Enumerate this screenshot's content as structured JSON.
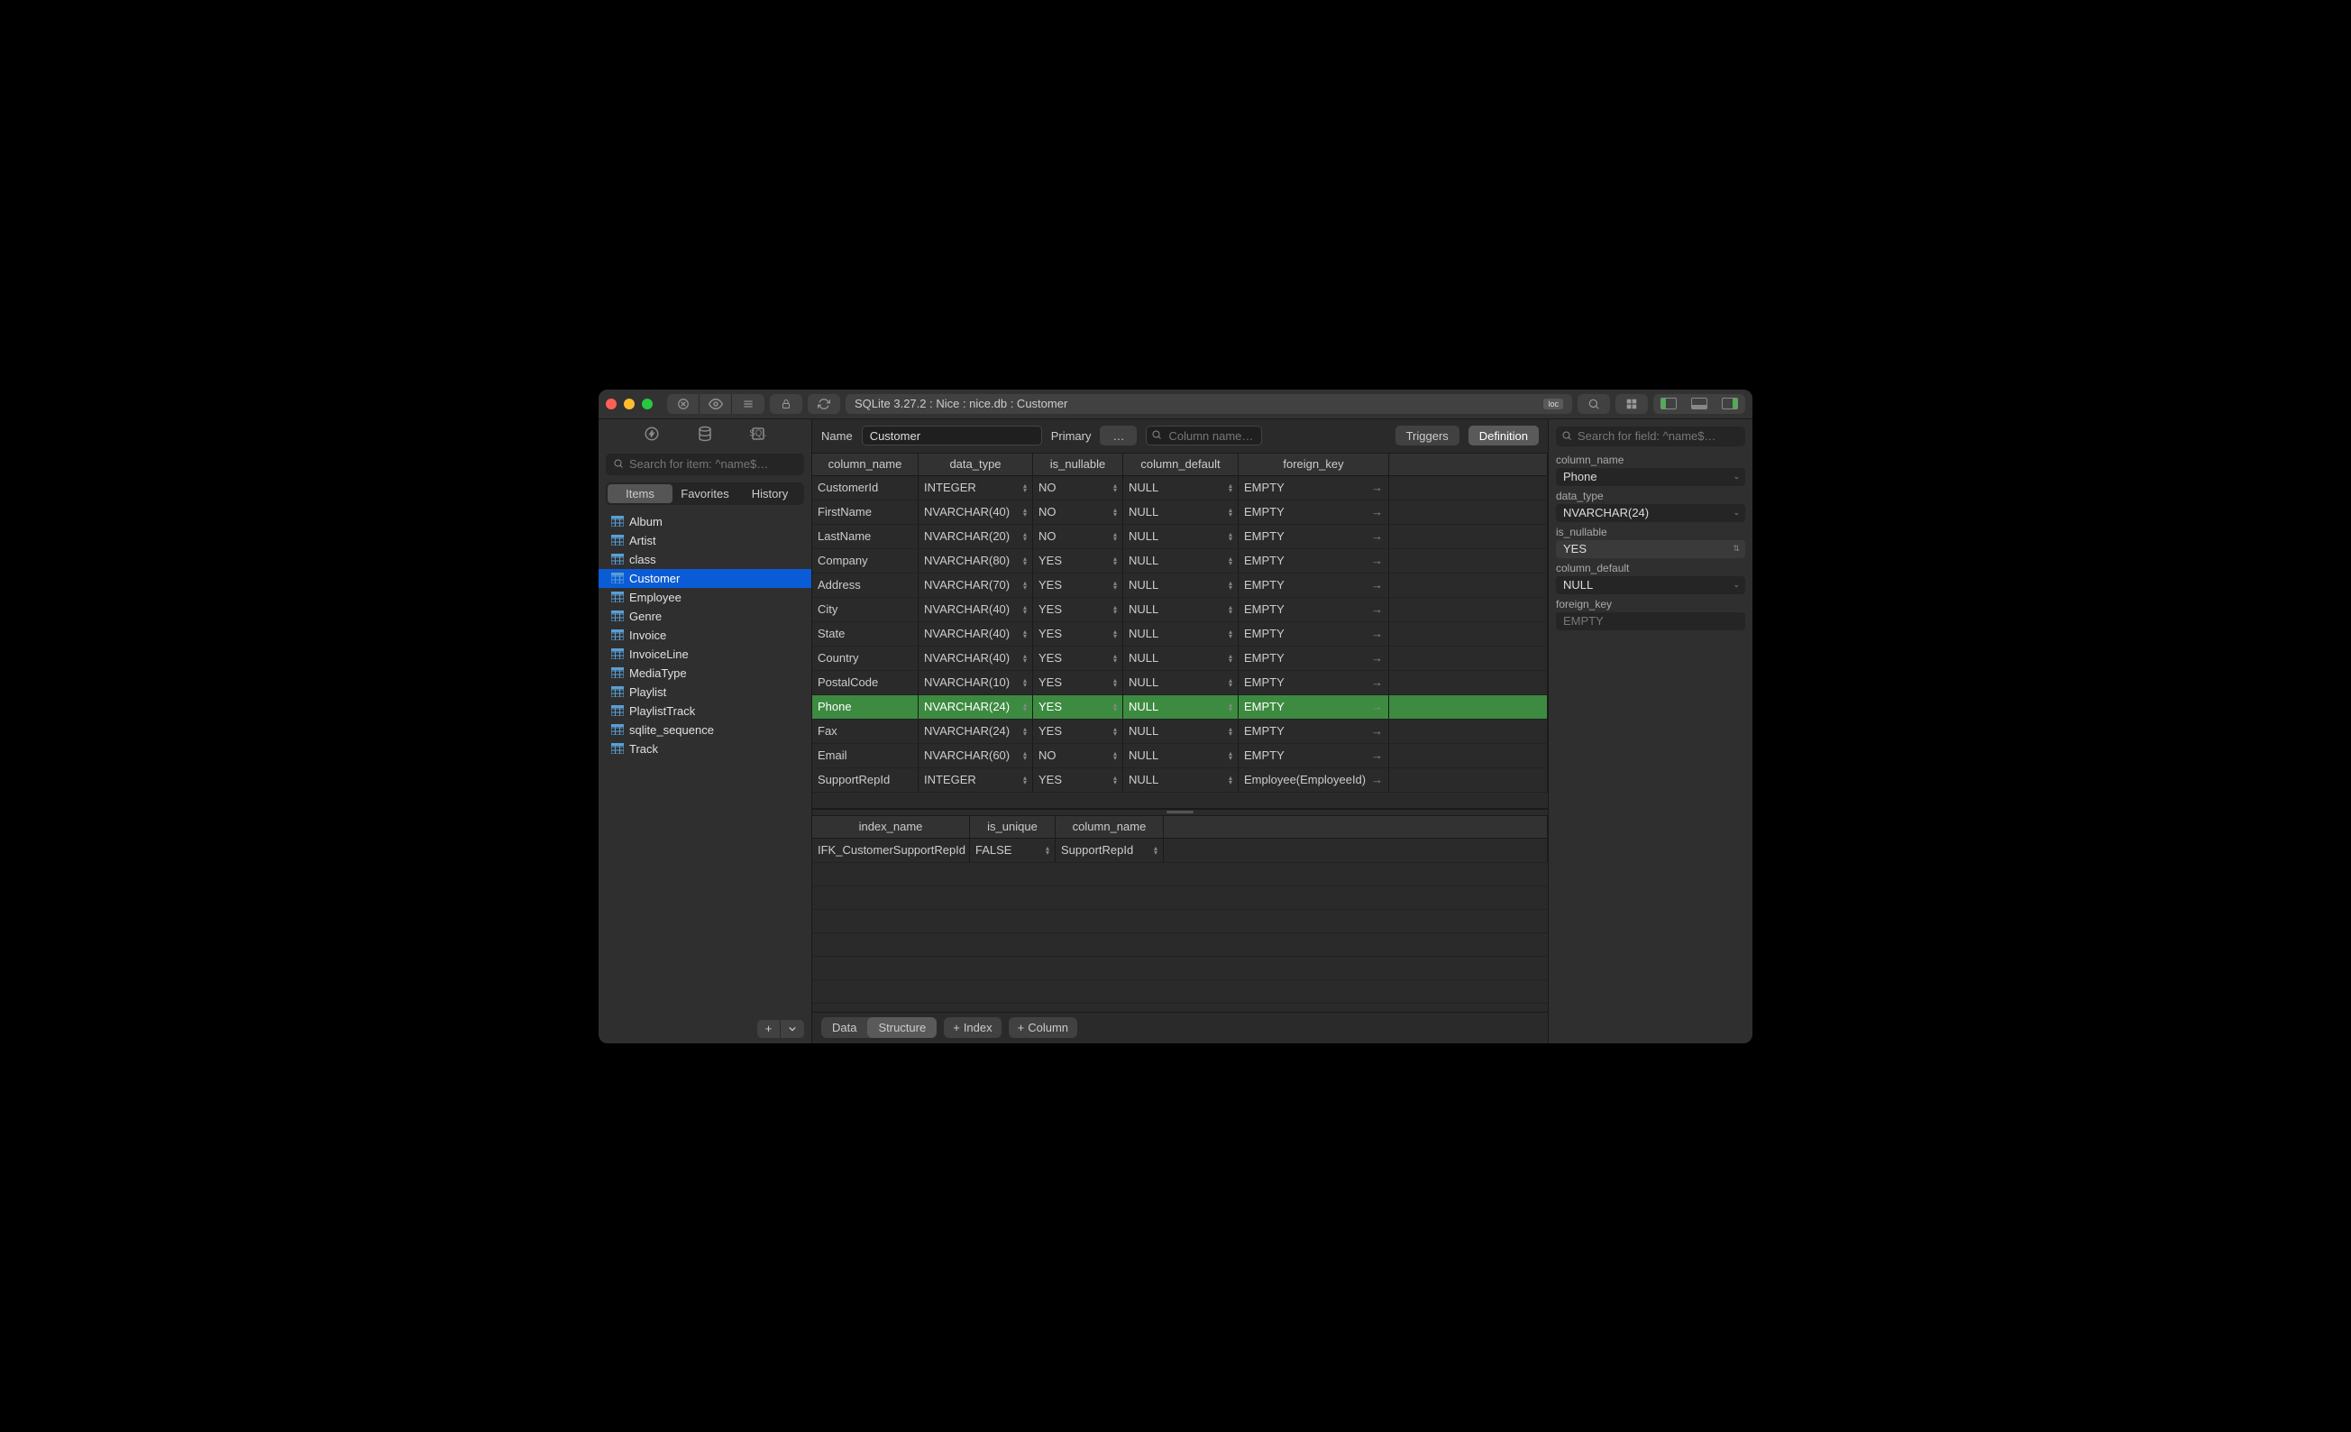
{
  "breadcrumb": "SQLite 3.27.2 : Nice : nice.db : Customer",
  "loc_badge": "loc",
  "sidebar": {
    "search_placeholder": "Search for item: ^name$…",
    "tabs": [
      "Items",
      "Favorites",
      "History"
    ],
    "active_tab": 0,
    "items": [
      "Album",
      "Artist",
      "class",
      "Customer",
      "Employee",
      "Genre",
      "Invoice",
      "InvoiceLine",
      "MediaType",
      "Playlist",
      "PlaylistTrack",
      "sqlite_sequence",
      "Track"
    ],
    "selected": "Customer"
  },
  "header": {
    "name_label": "Name",
    "name_value": "Customer",
    "primary_label": "Primary",
    "primary_value": "…",
    "col_search_placeholder": "Column name… (⌘F)",
    "triggers": "Triggers",
    "definition": "Definition"
  },
  "columns_table": {
    "headers": [
      "column_name",
      "data_type",
      "is_nullable",
      "column_default",
      "foreign_key"
    ],
    "rows": [
      {
        "name": "CustomerId",
        "type": "INTEGER",
        "nullable": "NO",
        "default": "NULL",
        "fk": "EMPTY"
      },
      {
        "name": "FirstName",
        "type": "NVARCHAR(40)",
        "nullable": "NO",
        "default": "NULL",
        "fk": "EMPTY"
      },
      {
        "name": "LastName",
        "type": "NVARCHAR(20)",
        "nullable": "NO",
        "default": "NULL",
        "fk": "EMPTY"
      },
      {
        "name": "Company",
        "type": "NVARCHAR(80)",
        "nullable": "YES",
        "default": "NULL",
        "fk": "EMPTY"
      },
      {
        "name": "Address",
        "type": "NVARCHAR(70)",
        "nullable": "YES",
        "default": "NULL",
        "fk": "EMPTY"
      },
      {
        "name": "City",
        "type": "NVARCHAR(40)",
        "nullable": "YES",
        "default": "NULL",
        "fk": "EMPTY"
      },
      {
        "name": "State",
        "type": "NVARCHAR(40)",
        "nullable": "YES",
        "default": "NULL",
        "fk": "EMPTY"
      },
      {
        "name": "Country",
        "type": "NVARCHAR(40)",
        "nullable": "YES",
        "default": "NULL",
        "fk": "EMPTY"
      },
      {
        "name": "PostalCode",
        "type": "NVARCHAR(10)",
        "nullable": "YES",
        "default": "NULL",
        "fk": "EMPTY"
      },
      {
        "name": "Phone",
        "type": "NVARCHAR(24)",
        "nullable": "YES",
        "default": "NULL",
        "fk": "EMPTY"
      },
      {
        "name": "Fax",
        "type": "NVARCHAR(24)",
        "nullable": "YES",
        "default": "NULL",
        "fk": "EMPTY"
      },
      {
        "name": "Email",
        "type": "NVARCHAR(60)",
        "nullable": "NO",
        "default": "NULL",
        "fk": "EMPTY"
      },
      {
        "name": "SupportRepId",
        "type": "INTEGER",
        "nullable": "YES",
        "default": "NULL",
        "fk": "Employee(EmployeeId)"
      }
    ],
    "selected_row": 9
  },
  "index_table": {
    "headers": [
      "index_name",
      "is_unique",
      "column_name"
    ],
    "rows": [
      {
        "name": "IFK_CustomerSupportRepId",
        "unique": "FALSE",
        "col": "SupportRepId"
      }
    ]
  },
  "footer": {
    "data": "Data",
    "structure": "Structure",
    "index": "Index",
    "column": "Column"
  },
  "rpanel": {
    "search_placeholder": "Search for field: ^name$…",
    "fields": {
      "column_name": {
        "label": "column_name",
        "value": "Phone"
      },
      "data_type": {
        "label": "data_type",
        "value": "NVARCHAR(24)"
      },
      "is_nullable": {
        "label": "is_nullable",
        "value": "YES"
      },
      "column_default": {
        "label": "column_default",
        "value": "NULL"
      },
      "foreign_key": {
        "label": "foreign_key",
        "value": "EMPTY"
      }
    }
  }
}
